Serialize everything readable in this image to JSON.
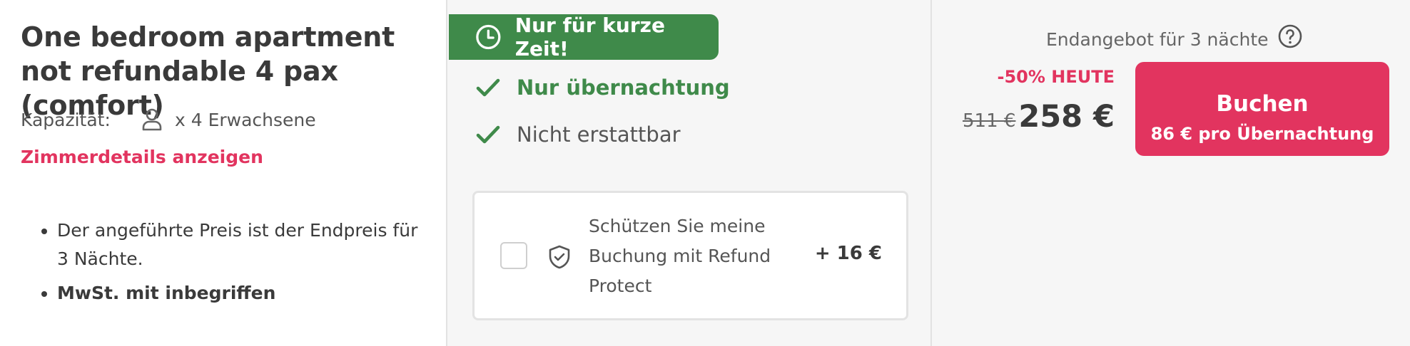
{
  "room": {
    "title": "One bedroom apartment not refundable 4 pax (comfort)",
    "capacity_label": "Kapazität:",
    "capacity_value": "x 4 Erwachsene",
    "details_link": "Zimmerdetails anzeigen",
    "notes": [
      "Der angeführte Preis ist der Endpreis für 3 Nächte.",
      "MwSt. mit inbegriffen"
    ]
  },
  "rate": {
    "promo_badge": "Nur für kurze Zeit!",
    "features": [
      "Nur übernachtung",
      "Nicht erstattbar"
    ],
    "protect_text": "Schützen Sie meine Buchung mit Refund Protect",
    "protect_price": "+ 16 €"
  },
  "pricing": {
    "offer_line": "Endangebot für 3 nächte",
    "discount": "-50% HEUTE",
    "old_price": "511 €",
    "new_price": "258 €",
    "book_label": "Buchen",
    "per_night": "86 € pro Übernachtung"
  },
  "colors": {
    "accent": "#e2345f",
    "green": "#3f8a4a"
  },
  "icons": {
    "person": "person-icon",
    "clock": "clock-icon",
    "check": "check-icon",
    "shield": "shield-check-icon",
    "help": "help-circle-icon"
  }
}
